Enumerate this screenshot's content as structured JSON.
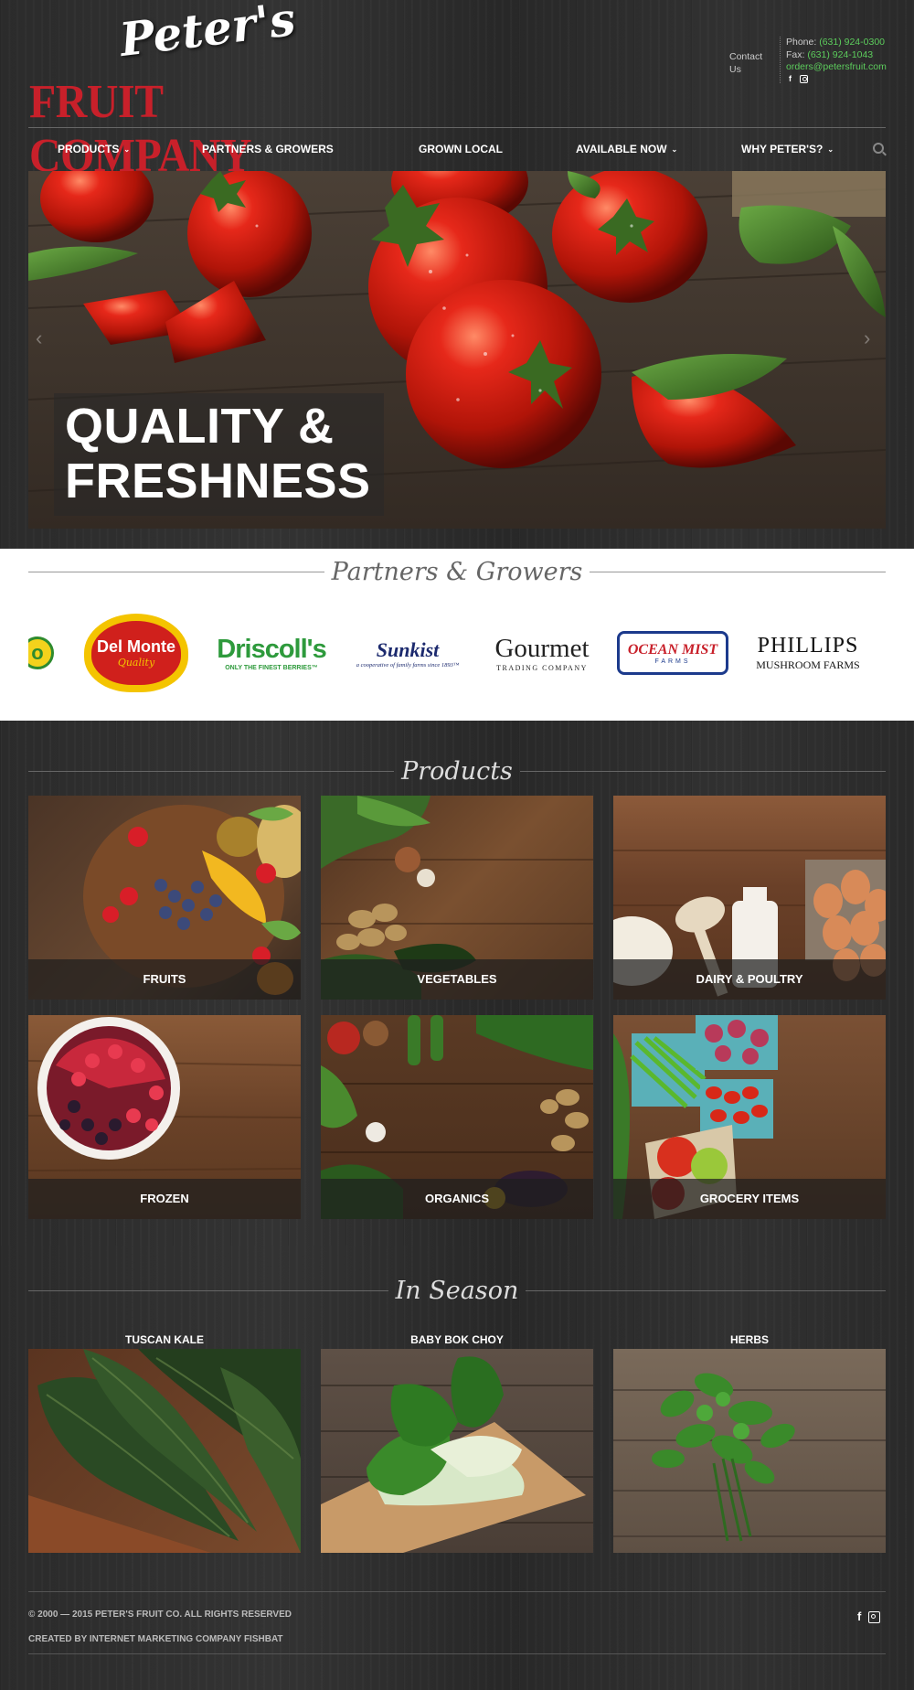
{
  "brand": {
    "script": "Peter's",
    "name": "FRUIT COMPANY",
    "accent": "#c8202a",
    "link_color": "#5ccc5c"
  },
  "contact": {
    "label": "Contact Us",
    "phone_label": "Phone:",
    "phone": "(631) 924-0300",
    "fax_label": "Fax:",
    "fax": "(631) 924-1043",
    "email": "orders@petersfruit.com",
    "social": [
      "facebook-icon",
      "instagram-icon"
    ]
  },
  "nav": {
    "items": [
      {
        "label": "PRODUCTS",
        "dropdown": true
      },
      {
        "label": "PARTNERS & GROWERS",
        "dropdown": false
      },
      {
        "label": "GROWN LOCAL",
        "dropdown": false
      },
      {
        "label": "AVAILABLE NOW",
        "dropdown": true
      },
      {
        "label": "WHY PETER'S?",
        "dropdown": true
      }
    ],
    "search_icon": "search-icon"
  },
  "hero": {
    "line1": "QUALITY &",
    "line2": "FRESHNESS",
    "prev_icon": "chevron-left-icon",
    "next_icon": "chevron-right-icon"
  },
  "partners": {
    "title": "Partners & Growers",
    "logos": [
      {
        "name": "o",
        "color": "#2e8b2e"
      },
      {
        "name": "Del Monte",
        "sub": "Quality",
        "color": "#d0201c"
      },
      {
        "name": "Driscoll's",
        "sub": "ONLY THE FINEST BERRIES™",
        "color": "#2e9a3c"
      },
      {
        "name": "Sunkist",
        "sub": "a cooperative of family farms since 1893™",
        "color": "#1c2a6e"
      },
      {
        "name": "Gourmet",
        "sub": "TRADING COMPANY",
        "color": "#222"
      },
      {
        "name": "OCEAN MIST",
        "sub": "FARMS",
        "color": "#c8202a"
      },
      {
        "name": "PHILLIPS",
        "sub": "MUSHROOM FARMS",
        "color": "#111"
      }
    ]
  },
  "products": {
    "title": "Products",
    "tiles": [
      {
        "label": "FRUITS"
      },
      {
        "label": "VEGETABLES"
      },
      {
        "label": "DAIRY & POULTRY"
      },
      {
        "label": "FROZEN"
      },
      {
        "label": "ORGANICS"
      },
      {
        "label": "GROCERY ITEMS"
      }
    ]
  },
  "season": {
    "title": "In Season",
    "items": [
      {
        "label": "TUSCAN KALE"
      },
      {
        "label": "BABY BOK CHOY"
      },
      {
        "label": "HERBS"
      }
    ]
  },
  "footer": {
    "copyright": "© 2000 — 2015 PETER'S FRUIT CO. ALL RIGHTS RESERVED",
    "credit": "CREATED BY INTERNET MARKETING COMPANY FISHBAT",
    "social": [
      "facebook-icon",
      "instagram-icon"
    ]
  }
}
